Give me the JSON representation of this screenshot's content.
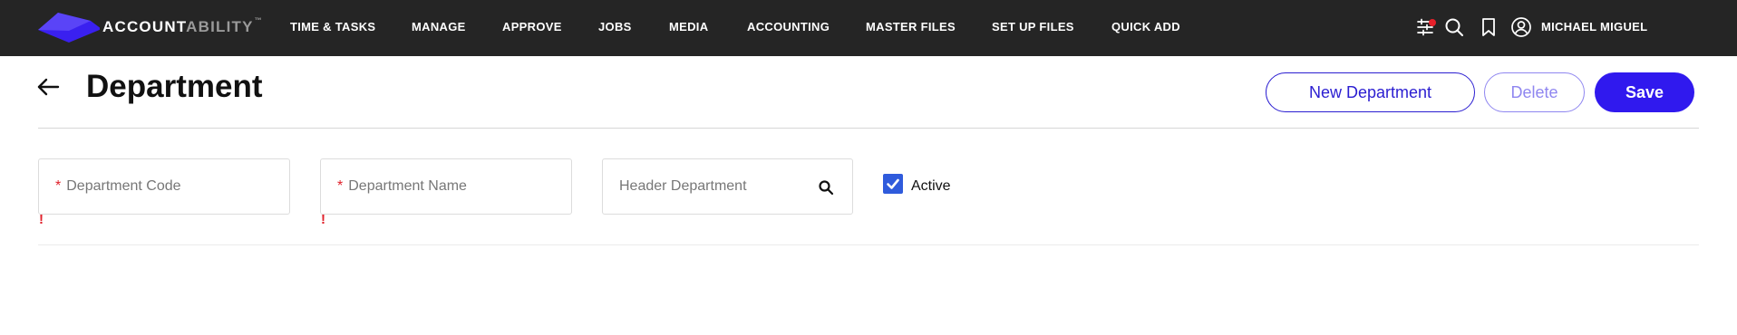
{
  "brand": {
    "name_bold": "ACCOUNT",
    "name_light": "ABILITY",
    "trademark": "™"
  },
  "nav": {
    "items": [
      {
        "label": "TIME & TASKS"
      },
      {
        "label": "MANAGE"
      },
      {
        "label": "APPROVE"
      },
      {
        "label": "JOBS"
      },
      {
        "label": "MEDIA"
      },
      {
        "label": "ACCOUNTING"
      },
      {
        "label": "MASTER FILES"
      },
      {
        "label": "SET UP FILES"
      },
      {
        "label": "QUICK ADD"
      }
    ],
    "icons": [
      "filter-sliders-icon",
      "search-icon",
      "bookmark-icon",
      "user-avatar-icon"
    ],
    "user_name": "MICHAEL MIGUEL"
  },
  "page": {
    "title": "Department",
    "buttons": {
      "new": "New Department",
      "delete": "Delete",
      "save": "Save"
    }
  },
  "form": {
    "department_code": {
      "label": "Department Code",
      "required": "*",
      "error": "!"
    },
    "department_name": {
      "label": "Department Name",
      "required": "*",
      "error": "!"
    },
    "header_department": {
      "label": "Header Department"
    },
    "active": {
      "label": "Active",
      "checked": true
    }
  },
  "colors": {
    "topbar": "#252525",
    "primary": "#3019ee",
    "primary_light": "#8f86f0",
    "required": "#e0202a",
    "checkbox": "#2f5bdc"
  }
}
